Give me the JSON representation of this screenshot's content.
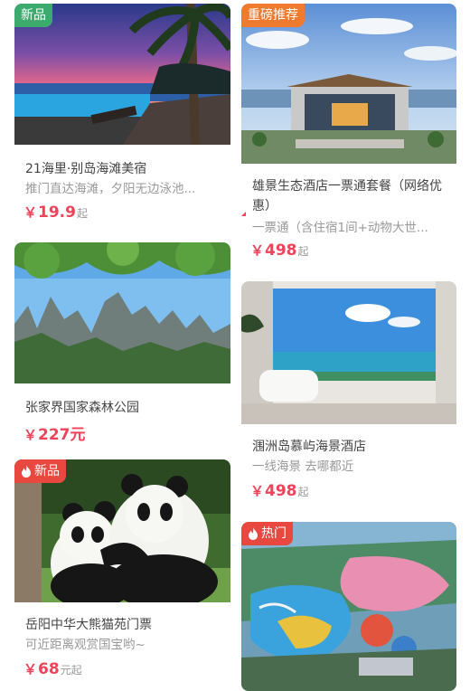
{
  "cards": [
    {
      "badge": "新品",
      "title": "21海里·别岛海滩美宿",
      "subtitle": "推门直达海滩，夕阳无边泳池...",
      "price_symbol": "￥",
      "price": "19.9",
      "price_unit": "起",
      "image": "beach-sunset-resort-photo"
    },
    {
      "badge": "重磅推荐",
      "title": "雄景生态酒店一票通套餐（网络优惠）",
      "subtitle": "一票通（含住宿1间+动物大世...",
      "price_symbol": "￥",
      "price": "498",
      "price_unit": "起",
      "image": "hotel-building-photo"
    },
    {
      "title": "张家界国家森林公园",
      "price_symbol": "￥",
      "price": "227元",
      "image": "karst-mountains-photo"
    },
    {
      "title": "涠洲岛慕屿海景酒店",
      "subtitle": "一线海景 去哪都近",
      "price_symbol": "￥",
      "price": "498",
      "price_unit": "起",
      "image": "ocean-view-bathroom-photo"
    },
    {
      "badge": "新品",
      "title": "岳阳中华大熊猫苑门票",
      "subtitle": "可近距离观赏国宝哟~",
      "price_symbol": "￥",
      "price": "68",
      "price_unit": "元起",
      "image": "giant-pandas-photo"
    },
    {
      "badge": "热门",
      "image": "water-park-aerial-photo"
    }
  ],
  "colors": {
    "price": "#f0435a",
    "badge_green": "#3daa6e",
    "badge_orange": "#f07a2e",
    "badge_red": "#e8483f"
  }
}
